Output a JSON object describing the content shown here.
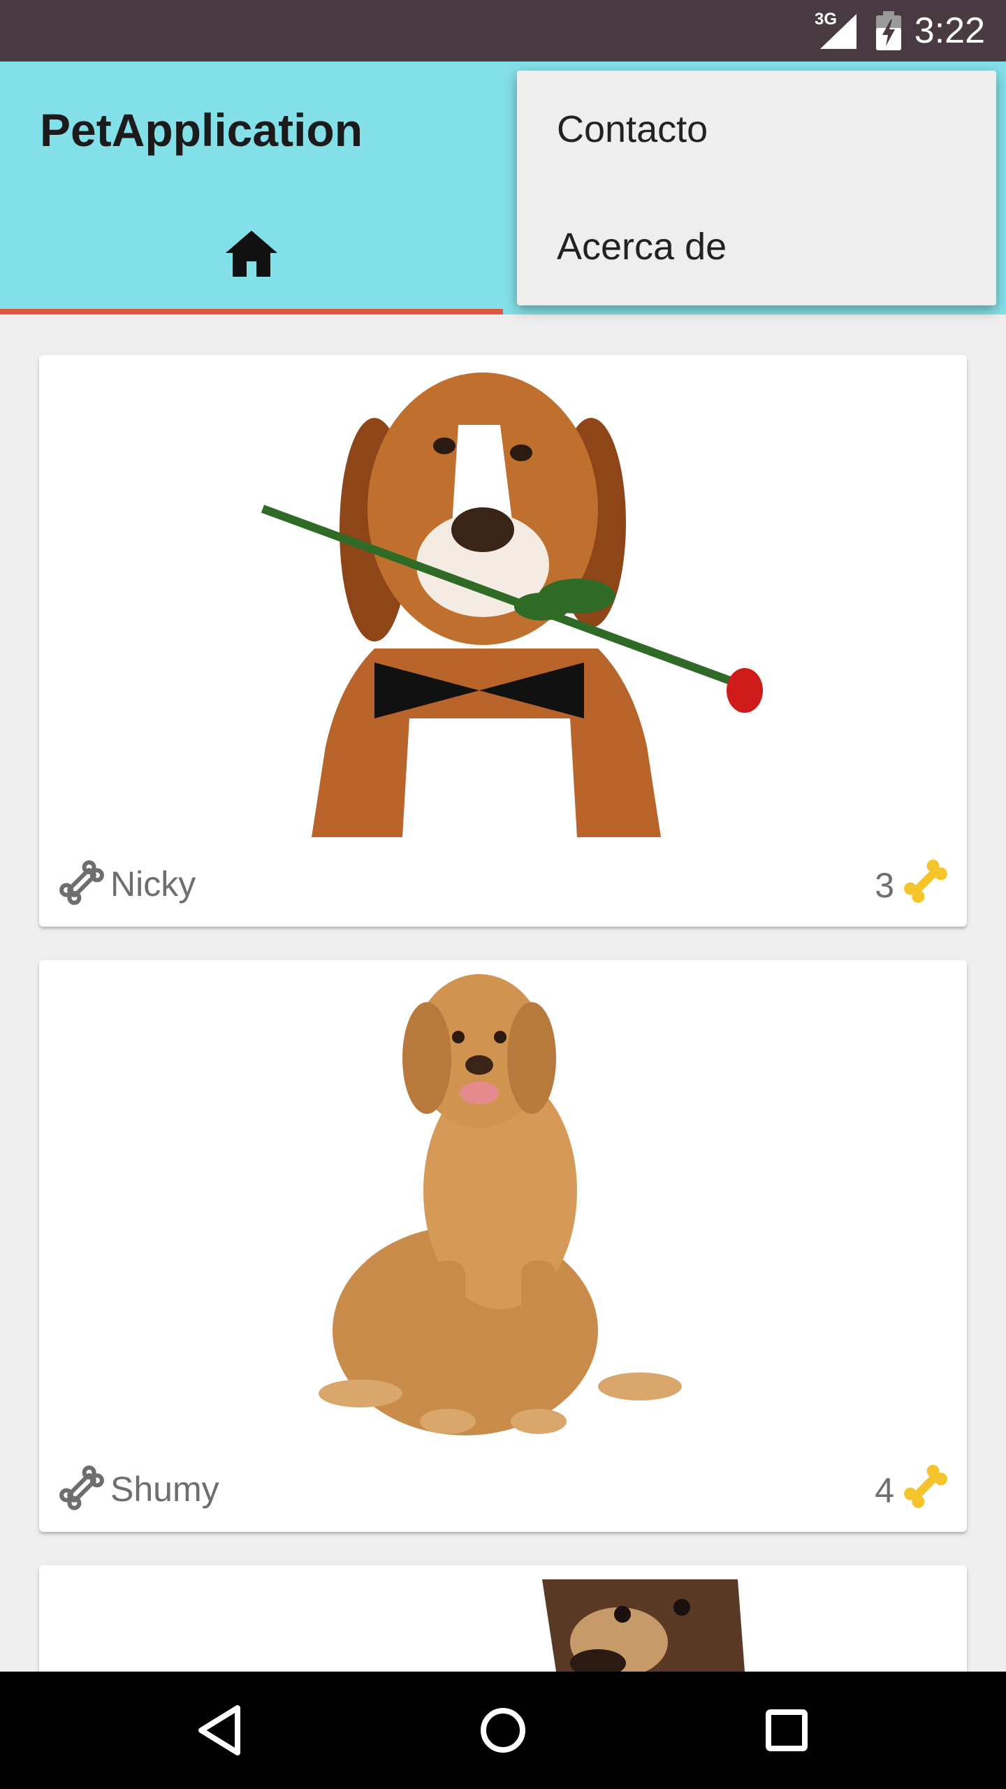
{
  "status_bar": {
    "network": "3G",
    "time": "3:22"
  },
  "app_bar": {
    "title": "PetApplication",
    "tabs": [
      {
        "icon": "home-icon",
        "selected": true
      }
    ],
    "background_color": "#84e0e8",
    "indicator_color": "#e2553e"
  },
  "overflow_menu": {
    "items": [
      {
        "label": "Contacto"
      },
      {
        "label": "Acerca de"
      }
    ]
  },
  "pets": [
    {
      "name": "Nicky",
      "likes": "3",
      "image": "beagle-with-rose-photo"
    },
    {
      "name": "Shumy",
      "likes": "4",
      "image": "golden-retriever-photo"
    },
    {
      "name": "",
      "likes": "",
      "image": "german-shepherd-photo"
    }
  ],
  "nav_bar": {
    "buttons": [
      "back-icon",
      "home-circle-icon",
      "recents-icon"
    ]
  }
}
